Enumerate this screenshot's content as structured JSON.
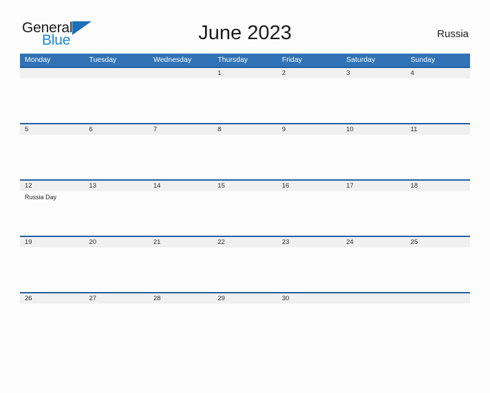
{
  "brand": {
    "name_part1": "General",
    "name_part2": "Blue",
    "flag_color": "#1b70b8",
    "blue_text_color": "#1b86d6"
  },
  "header": {
    "title": "June 2023",
    "country": "Russia"
  },
  "theme": {
    "header_blue": "#3173b5",
    "row_border_blue": "#1f5fa0",
    "band_gray": "#eff0ef",
    "page_background": "#fdfdfd"
  },
  "calendar": {
    "weekdays": [
      "Monday",
      "Tuesday",
      "Wednesday",
      "Thursday",
      "Friday",
      "Saturday",
      "Sunday"
    ],
    "weeks": [
      {
        "days": [
          {
            "num": "",
            "events": []
          },
          {
            "num": "",
            "events": []
          },
          {
            "num": "",
            "events": []
          },
          {
            "num": "1",
            "events": []
          },
          {
            "num": "2",
            "events": []
          },
          {
            "num": "3",
            "events": []
          },
          {
            "num": "4",
            "events": []
          }
        ]
      },
      {
        "days": [
          {
            "num": "5",
            "events": []
          },
          {
            "num": "6",
            "events": []
          },
          {
            "num": "7",
            "events": []
          },
          {
            "num": "8",
            "events": []
          },
          {
            "num": "9",
            "events": []
          },
          {
            "num": "10",
            "events": []
          },
          {
            "num": "11",
            "events": []
          }
        ]
      },
      {
        "days": [
          {
            "num": "12",
            "events": [
              "Russia Day"
            ]
          },
          {
            "num": "13",
            "events": []
          },
          {
            "num": "14",
            "events": []
          },
          {
            "num": "15",
            "events": []
          },
          {
            "num": "16",
            "events": []
          },
          {
            "num": "17",
            "events": []
          },
          {
            "num": "18",
            "events": []
          }
        ]
      },
      {
        "days": [
          {
            "num": "19",
            "events": []
          },
          {
            "num": "20",
            "events": []
          },
          {
            "num": "21",
            "events": []
          },
          {
            "num": "22",
            "events": []
          },
          {
            "num": "23",
            "events": []
          },
          {
            "num": "24",
            "events": []
          },
          {
            "num": "25",
            "events": []
          }
        ]
      },
      {
        "days": [
          {
            "num": "26",
            "events": []
          },
          {
            "num": "27",
            "events": []
          },
          {
            "num": "28",
            "events": []
          },
          {
            "num": "29",
            "events": []
          },
          {
            "num": "30",
            "events": []
          },
          {
            "num": "",
            "events": []
          },
          {
            "num": "",
            "events": []
          }
        ]
      }
    ]
  }
}
